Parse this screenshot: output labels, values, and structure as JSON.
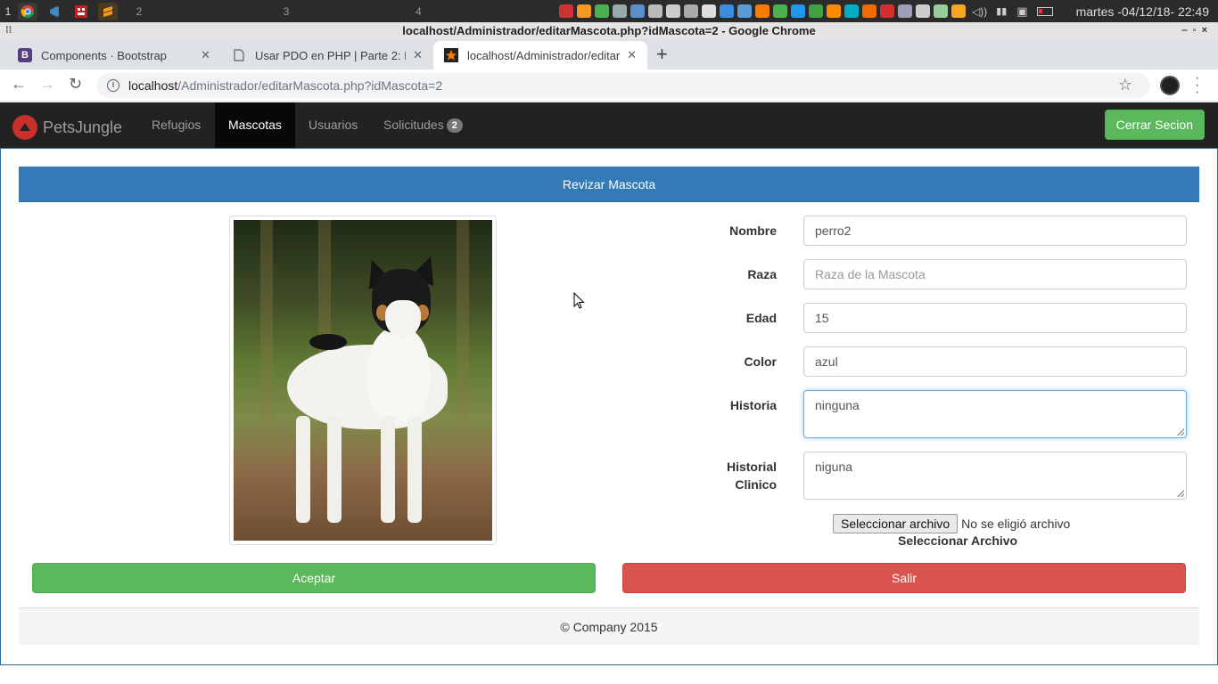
{
  "taskbar": {
    "workspaces": [
      "1",
      "2",
      "3",
      "4"
    ],
    "clock": "martes -04/12/18- 22:49"
  },
  "window": {
    "title": "localhost/Administrador/editarMascota.php?idMascota=2 - Google Chrome"
  },
  "tabs": [
    {
      "label": "Components · Bootstrap",
      "favicon_letter": "B",
      "favicon_color": "#563d7c"
    },
    {
      "label": "Usar PDO en PHP | Parte 2: I",
      "favicon": "page-icon"
    },
    {
      "label": "localhost/Administrador/editar",
      "favicon": "star-icon",
      "active": true
    }
  ],
  "address": {
    "host": "localhost",
    "path": "/Administrador/editarMascota.php?idMascota=2"
  },
  "navbar": {
    "brand": "PetsJungle",
    "links": [
      "Refugios",
      "Mascotas",
      "Usuarios",
      "Solicitudes"
    ],
    "active_link": "Mascotas",
    "solicitudes_badge": "2",
    "logout_label": "Cerrar Secion"
  },
  "panel": {
    "title": "Revizar Mascota"
  },
  "form": {
    "nombre_label": "Nombre",
    "nombre_value": "perro2",
    "raza_label": "Raza",
    "raza_placeholder": "Raza de la Mascota",
    "edad_label": "Edad",
    "edad_value": "15",
    "color_label": "Color",
    "color_value": "azul",
    "historia_label": "Historia",
    "historia_value": "ninguna",
    "historial_label_1": "Historial",
    "historial_label_2": "Clinico",
    "historial_value": "niguna",
    "file_button": "Seleccionar archivo",
    "file_status": "No se eligió archivo",
    "file_caption": "Seleccionar Archivo"
  },
  "actions": {
    "accept": "Aceptar",
    "exit": "Salir"
  },
  "footer": {
    "text": "© Company 2015"
  },
  "colors": {
    "primary": "#337ab7",
    "success": "#5cb85c",
    "danger": "#d9534f",
    "navbar": "#222222"
  }
}
